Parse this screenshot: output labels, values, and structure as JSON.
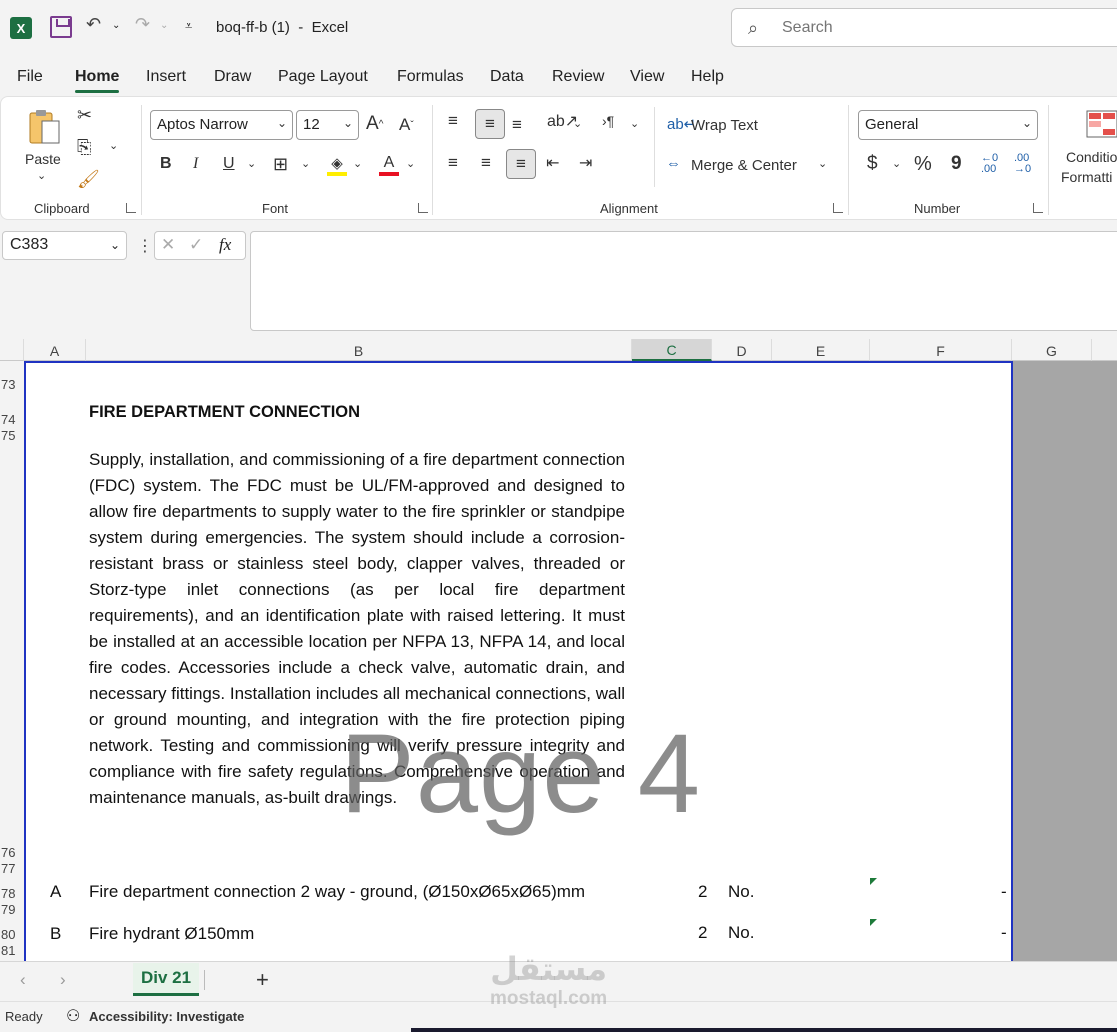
{
  "titlebar": {
    "app_logo": "X",
    "doc_title": "boq-ff-b (1)  -  Excel",
    "search_placeholder": "Search"
  },
  "menu": {
    "tabs": [
      "File",
      "Home",
      "Insert",
      "Draw",
      "Page Layout",
      "Formulas",
      "Data",
      "Review",
      "View",
      "Help"
    ],
    "active": "Home"
  },
  "ribbon": {
    "clipboard": {
      "paste_label": "Paste",
      "group_label": "Clipboard"
    },
    "font": {
      "font_name": "Aptos Narrow",
      "font_size": "12",
      "bold": "B",
      "italic": "I",
      "underline": "U",
      "group_label": "Font"
    },
    "alignment": {
      "wrap_text": "Wrap Text",
      "merge_center": "Merge & Center",
      "group_label": "Alignment"
    },
    "number": {
      "format": "General",
      "currency": "$",
      "percent": "%",
      "comma": "9",
      "group_label": "Number"
    },
    "styles": {
      "conditional_formatting_line1": "Conditio",
      "conditional_formatting_line2": "Formatti"
    }
  },
  "formula_bar": {
    "name_box": "C383",
    "fx": "fx",
    "formula": ""
  },
  "grid": {
    "columns": [
      "A",
      "B",
      "C",
      "D",
      "E",
      "F",
      "G"
    ],
    "selected_column": "C",
    "row_numbers": [
      "73",
      "74",
      "75",
      "76",
      "77",
      "78",
      "79",
      "80",
      "81"
    ],
    "section_title": "FIRE DEPARTMENT CONNECTION",
    "description": "Supply, installation, and commissioning of a fire department connection (FDC) system. The FDC must be UL/FM-approved and designed to allow fire departments to supply water to the fire sprinkler or standpipe system during emergencies. The system should include a corrosion-resistant brass or stainless steel body, clapper valves, threaded or Storz-type inlet connections (as per local fire department requirements), and an identification plate with raised lettering. It must be installed at an accessible location per NFPA 13, NFPA 14, and local fire codes. Accessories include a check valve, automatic drain, and necessary fittings. Installation includes all mechanical connections, wall or ground mounting, and integration with the fire protection piping network. Testing and commissioning will verify pressure integrity and compliance with fire safety regulations. Comprehensive operation and maintenance manuals, as-built drawings.",
    "items": [
      {
        "item": "A",
        "description": "Fire department connection 2 way - ground, (Ø150xØ65xØ65)mm",
        "qty": "2",
        "unit": "No.",
        "amount": "-"
      },
      {
        "item": "B",
        "description": "Fire hydrant Ø150mm",
        "qty": "2",
        "unit": "No.",
        "amount": "-"
      }
    ],
    "page_watermark": "Page 4"
  },
  "sheets": {
    "tabs": [
      "Div 21"
    ],
    "add": "+"
  },
  "status": {
    "ready": "Ready",
    "accessibility": "Accessibility: Investigate"
  },
  "overlay_watermark": {
    "arabic": "مستقل",
    "latin": "mostaql.com"
  }
}
